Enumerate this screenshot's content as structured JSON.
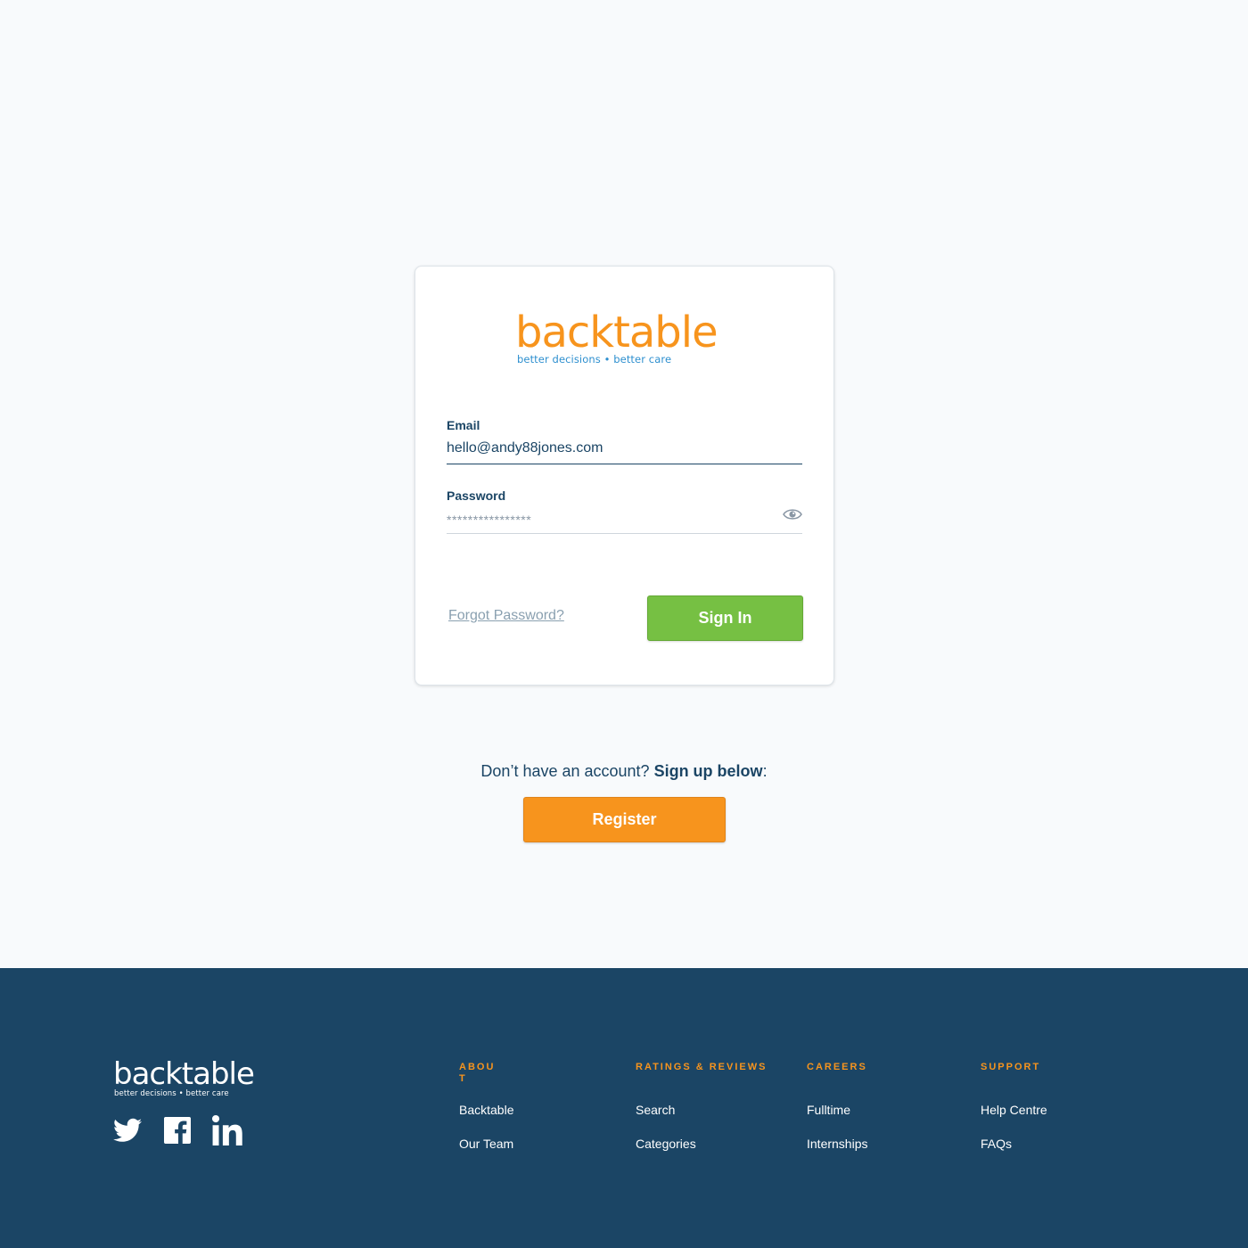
{
  "brand": {
    "name": "backtable",
    "tagline": "better decisions • better care",
    "primary_color": "#f7941d",
    "accent_color": "#2d8fcf",
    "navy": "#1b4565",
    "green": "#76c043"
  },
  "login": {
    "email_label": "Email",
    "email_value": "hello@andy88jones.com",
    "password_label": "Password",
    "password_value": "****************",
    "password_toggle_icon": "eye-icon",
    "forgot_label": "Forgot Password?",
    "signin_label": "Sign In"
  },
  "signup": {
    "prompt": "Don’t have an account? ",
    "emphasis": "Sign up below",
    "suffix": ":",
    "register_label": "Register"
  },
  "footer": {
    "logo_text": "backtable",
    "logo_tagline": "better decisions • better care",
    "social": [
      "twitter-icon",
      "facebook-icon",
      "linkedin-icon"
    ],
    "columns": [
      {
        "heading": "ABOUT",
        "links": [
          "Backtable",
          "Our Team"
        ]
      },
      {
        "heading": "RATINGS & REVIEWS",
        "links": [
          "Search",
          "Categories"
        ]
      },
      {
        "heading": "CAREERS",
        "links": [
          "Fulltime",
          "Internships"
        ]
      },
      {
        "heading": "SUPPORT",
        "links": [
          "Help Centre",
          "FAQs"
        ]
      }
    ]
  }
}
